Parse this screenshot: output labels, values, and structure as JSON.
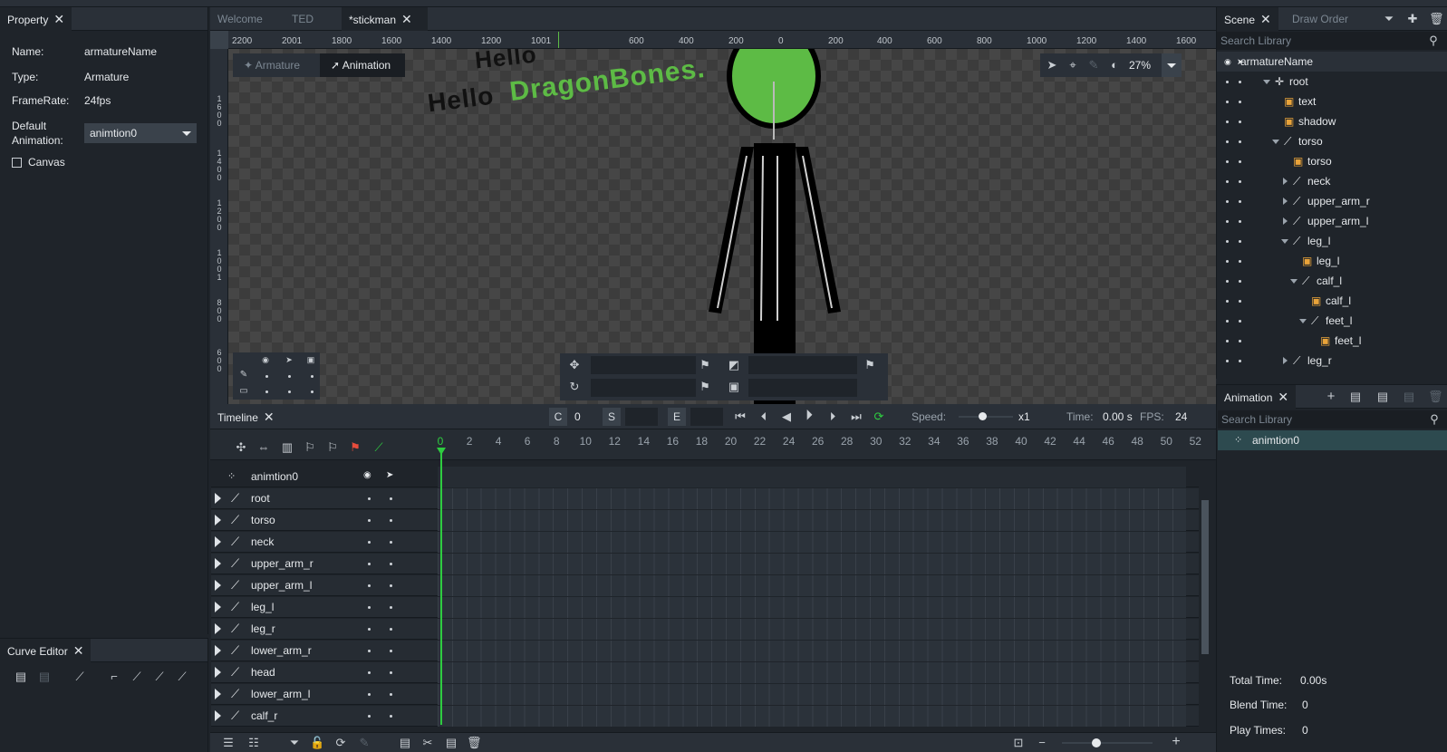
{
  "property_panel": {
    "tab": "Property",
    "name_label": "Name:",
    "name_value": "armatureName",
    "type_label": "Type:",
    "type_value": "Armature",
    "framerate_label": "FrameRate:",
    "framerate_value": "24fps",
    "default_anim_label": "Default Animation:",
    "default_anim_value": "animtion0",
    "canvas_label": "Canvas"
  },
  "curve_editor": {
    "tab": "Curve Editor"
  },
  "doc_tabs": [
    {
      "label": "Welcome"
    },
    {
      "label": "TED"
    },
    {
      "label": "*stickman"
    }
  ],
  "ruler": {
    "labels": [
      "2200",
      "2001",
      "1800",
      "1600",
      "1400",
      "1200",
      "1001",
      "600",
      "400",
      "200",
      "0",
      "200",
      "400",
      "600",
      "800",
      "1000",
      "1200",
      "1400",
      "1600"
    ]
  },
  "vruler": {
    "labels": [
      "1600",
      "1400",
      "1200",
      "1001",
      "800",
      "600"
    ]
  },
  "mode_switch": {
    "armature": "Armature",
    "animation": "Animation"
  },
  "zoom": "27%",
  "canvas_text": {
    "hello1": "Hello",
    "hello2": "Hello",
    "dragon": "DragonBones."
  },
  "timeline": {
    "tab": "Timeline",
    "c_label": "C",
    "c_value": "0",
    "s_label": "S",
    "e_label": "E",
    "speed_label": "Speed:",
    "speed_value": "x1",
    "time_label": "Time:",
    "time_value": "0.00 s",
    "fps_label": "FPS:",
    "fps_value": "24",
    "frames": [
      "0",
      "2",
      "4",
      "6",
      "8",
      "10",
      "12",
      "14",
      "16",
      "18",
      "20",
      "22",
      "24",
      "26",
      "28",
      "30",
      "32",
      "34",
      "36",
      "38",
      "40",
      "42",
      "44",
      "46",
      "48",
      "50",
      "52"
    ],
    "anim_name": "animtion0",
    "tracks": [
      "root",
      "torso",
      "neck",
      "upper_arm_r",
      "upper_arm_l",
      "leg_l",
      "leg_r",
      "lower_arm_r",
      "head",
      "lower_arm_l",
      "calf_r"
    ]
  },
  "scene_panel": {
    "tab": "Scene",
    "tab2": "Draw Order",
    "search_placeholder": "Search Library",
    "tree": [
      {
        "label": "armatureName",
        "depth": 0,
        "kind": "armature"
      },
      {
        "label": "root",
        "depth": 1,
        "kind": "root"
      },
      {
        "label": "text",
        "depth": 2,
        "kind": "image"
      },
      {
        "label": "shadow",
        "depth": 2,
        "kind": "image"
      },
      {
        "label": "torso",
        "depth": 2,
        "kind": "bone"
      },
      {
        "label": "torso",
        "depth": 3,
        "kind": "image"
      },
      {
        "label": "neck",
        "depth": 3,
        "kind": "bone"
      },
      {
        "label": "upper_arm_r",
        "depth": 3,
        "kind": "bone"
      },
      {
        "label": "upper_arm_l",
        "depth": 3,
        "kind": "bone"
      },
      {
        "label": "leg_l",
        "depth": 3,
        "kind": "bone"
      },
      {
        "label": "leg_l",
        "depth": 4,
        "kind": "image"
      },
      {
        "label": "calf_l",
        "depth": 4,
        "kind": "bone"
      },
      {
        "label": "calf_l",
        "depth": 5,
        "kind": "image"
      },
      {
        "label": "feet_l",
        "depth": 5,
        "kind": "bone"
      },
      {
        "label": "feet_l",
        "depth": 6,
        "kind": "image"
      },
      {
        "label": "leg_r",
        "depth": 3,
        "kind": "bone"
      }
    ]
  },
  "animation_panel": {
    "tab": "Animation",
    "search_placeholder": "Search Library",
    "item": "animtion0",
    "total_time_label": "Total Time:",
    "total_time_value": "0.00s",
    "blend_time_label": "Blend Time:",
    "blend_time_value": "0",
    "play_times_label": "Play Times:",
    "play_times_value": "0"
  },
  "colors": {
    "accent_green": "#5dbb45",
    "playhead": "#2ecc40",
    "panel_bg": "#1f242a",
    "header_bg": "#2a3038"
  }
}
